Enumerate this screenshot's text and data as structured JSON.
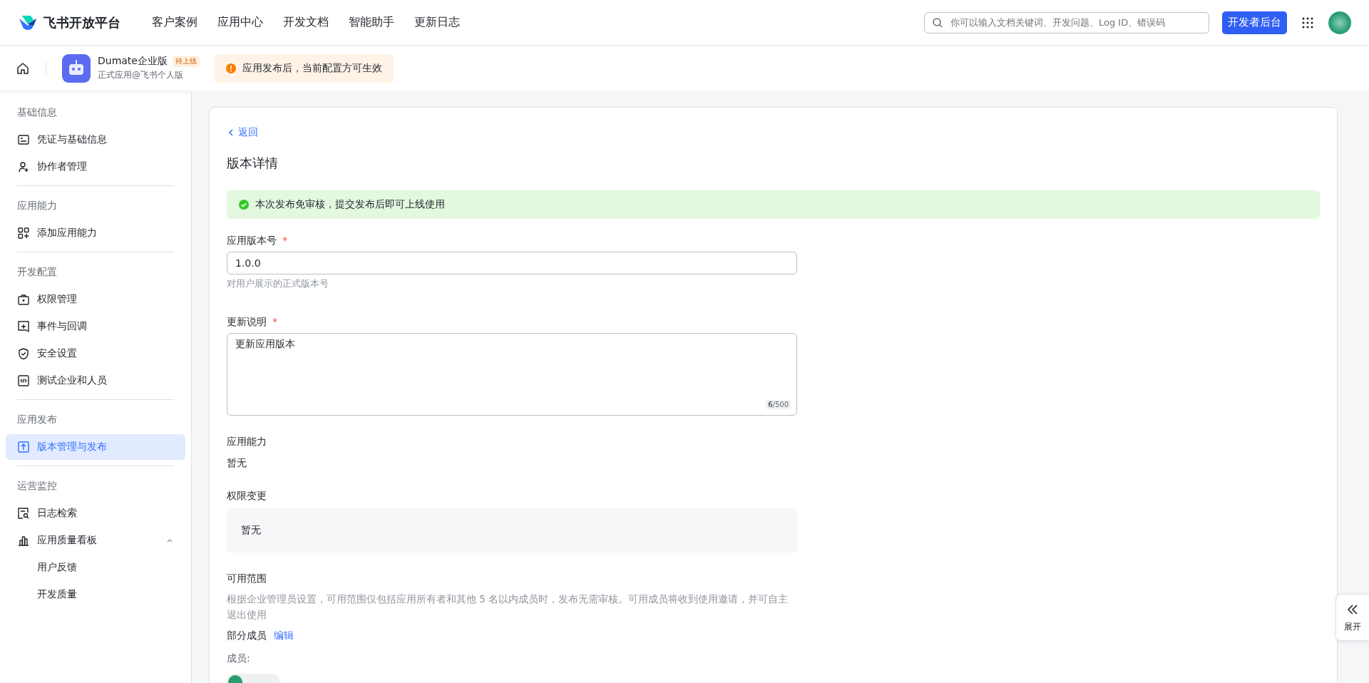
{
  "brand": {
    "name": "飞书开放平台"
  },
  "nav": [
    {
      "label": "客户案例"
    },
    {
      "label": "应用中心"
    },
    {
      "label": "开发文档"
    },
    {
      "label": "智能助手"
    },
    {
      "label": "更新日志"
    }
  ],
  "search": {
    "placeholder": "你可以输入文档关键词、开发问题、Log ID、错误码"
  },
  "console_button": "开发者后台",
  "app": {
    "name": "Dumate企业版",
    "status": "待上线",
    "subtitle": "正式应用@飞书个人版"
  },
  "notice": "应用发布后，当前配置方可生效",
  "sidebar": [
    {
      "title": "基础信息",
      "items": [
        {
          "label": "凭证与基础信息",
          "kind": "card",
          "selected": false
        },
        {
          "label": "协作者管理",
          "kind": "user-add",
          "selected": false
        }
      ]
    },
    {
      "title": "应用能力",
      "items": [
        {
          "label": "添加应用能力",
          "kind": "grid-add",
          "selected": false
        }
      ]
    },
    {
      "title": "开发配置",
      "items": [
        {
          "label": "权限管理",
          "kind": "briefcase",
          "selected": false
        },
        {
          "label": "事件与回调",
          "kind": "plus-box",
          "selected": false
        },
        {
          "label": "安全设置",
          "kind": "shield",
          "selected": false
        },
        {
          "label": "测试企业和人员",
          "kind": "code",
          "selected": false
        }
      ]
    },
    {
      "title": "应用发布",
      "items": [
        {
          "label": "版本管理与发布",
          "kind": "upload",
          "selected": true
        }
      ]
    },
    {
      "title": "运营监控",
      "items": [
        {
          "label": "日志检索",
          "kind": "log-search",
          "selected": false
        },
        {
          "label": "应用质量看板",
          "kind": "bar-chart",
          "selected": false,
          "expanded": true,
          "children": [
            {
              "label": "用户反馈",
              "selected": false
            },
            {
              "label": "开发质量",
              "selected": false
            }
          ]
        }
      ]
    }
  ],
  "back_link": "返回",
  "page_title": "版本详情",
  "success_alert": "本次发布免审核，提交发布后即可上线使用",
  "version_field": {
    "label": "应用版本号",
    "required_mark": "*",
    "value": "1.0.0",
    "hint": "对用户展示的正式版本号"
  },
  "notes_field": {
    "label": "更新说明",
    "required_mark": "*",
    "value": "更新应用版本",
    "count": "6",
    "limit": "/500"
  },
  "capabilities": {
    "label": "应用能力",
    "value": "暂无"
  },
  "permission_changes": {
    "label": "权限变更",
    "value": "暂无"
  },
  "scope": {
    "label": "可用范围",
    "description": "根据企业管理员设置，可用范围仅包括应用所有者和其他 5 名以内成员时，发布无需审核。可用成员将收到使用邀请，并可自主退出使用",
    "mode": "部分成员",
    "edit_link": "编辑",
    "members_label": "成员:"
  },
  "expand_panel": {
    "label": "展开"
  }
}
